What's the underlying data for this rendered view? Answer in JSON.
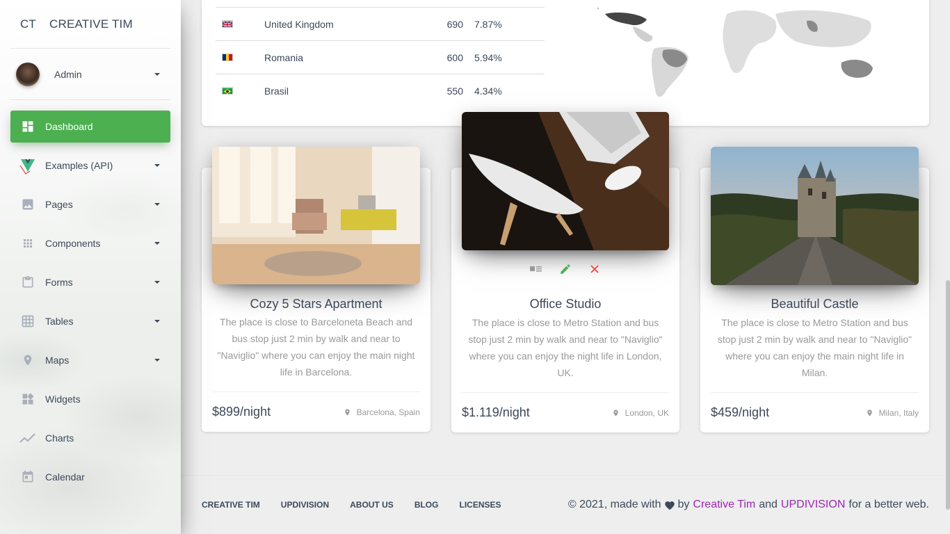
{
  "brand": {
    "mini": "CT",
    "name": "CREATIVE TIM"
  },
  "user": {
    "name": "Admin"
  },
  "nav": [
    {
      "label": "Dashboard",
      "icon": "dashboard-icon",
      "active": true
    },
    {
      "label": "Examples (API)",
      "icon": "vue-logo-icon",
      "caret": true
    },
    {
      "label": "Pages",
      "icon": "image-icon",
      "caret": true
    },
    {
      "label": "Components",
      "icon": "apps-grid-icon",
      "caret": true
    },
    {
      "label": "Forms",
      "icon": "clipboard-icon",
      "caret": true
    },
    {
      "label": "Tables",
      "icon": "grid-icon",
      "caret": true
    },
    {
      "label": "Maps",
      "icon": "place-icon",
      "caret": true
    },
    {
      "label": "Widgets",
      "icon": "widgets-icon"
    },
    {
      "label": "Charts",
      "icon": "timeline-icon"
    },
    {
      "label": "Calendar",
      "icon": "calendar-icon"
    }
  ],
  "countries": [
    {
      "flag": "uk-flag-icon",
      "name": "United Kingdom",
      "count": "690",
      "pct": "7.87%"
    },
    {
      "flag": "romania-flag-icon",
      "name": "Romania",
      "count": "600",
      "pct": "5.94%"
    },
    {
      "flag": "brazil-flag-icon",
      "name": "Brasil",
      "count": "550",
      "pct": "4.34%"
    }
  ],
  "cards": [
    {
      "title": "Cozy 5 Stars Apartment",
      "description": "The place is close to Barceloneta Beach and bus stop just 2 min by walk and near to \"Naviglio\" where you can enjoy the main night life in Barcelona.",
      "price": "$899/night",
      "location": "Barcelona, Spain"
    },
    {
      "title": "Office Studio",
      "description": "The place is close to Metro Station and bus stop just 2 min by walk and near to \"Naviglio\" where you can enjoy the night life in London, UK.",
      "price": "$1.119/night",
      "location": "London, UK"
    },
    {
      "title": "Beautiful Castle",
      "description": "The place is close to Metro Station and bus stop just 2 min by walk and near to \"Naviglio\" where you can enjoy the main night life in Milan.",
      "price": "$459/night",
      "location": "Milan, Italy"
    }
  ],
  "footer": {
    "links": [
      "CREATIVE TIM",
      "UPDIVISION",
      "ABOUT US",
      "BLOG",
      "LICENSES"
    ],
    "copy_prefix": "© 2021, made with",
    "copy_by": "by",
    "author1": "Creative Tim",
    "copy_and": "and",
    "author2": "UPDIVISION",
    "copy_suffix": "for a better web."
  },
  "colors": {
    "active": "#4caf50",
    "link": "#9c27b0",
    "danger": "#f44336",
    "success": "#4caf50"
  }
}
